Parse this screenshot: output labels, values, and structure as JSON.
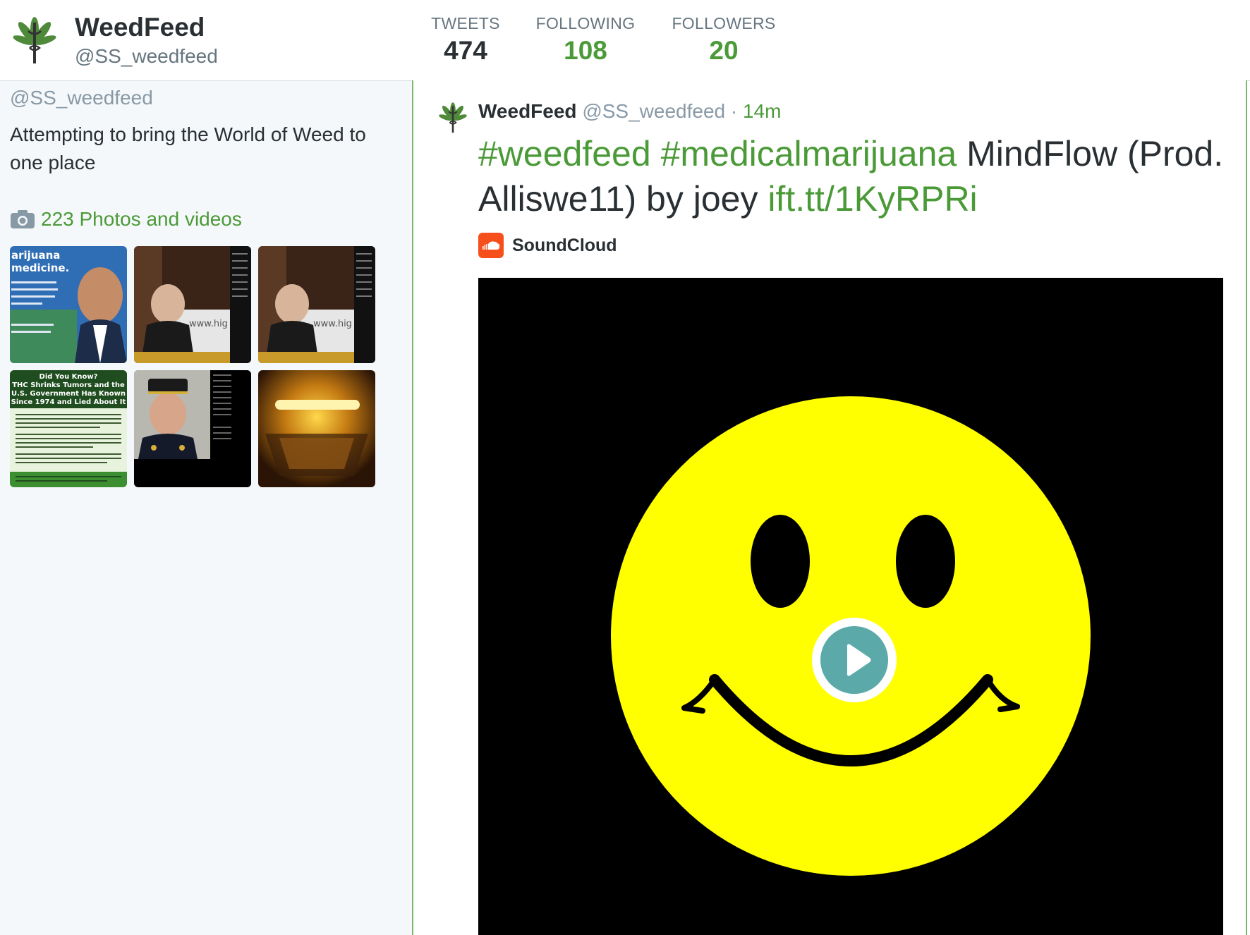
{
  "header": {
    "name": "WeedFeed",
    "handle": "@SS_weedfeed",
    "avatar_icon": "cannabis-leaf-caduceus-icon",
    "stats": [
      {
        "label": "TWEETS",
        "value": "474",
        "active": true
      },
      {
        "label": "FOLLOWING",
        "value": "108",
        "active": false
      },
      {
        "label": "FOLLOWERS",
        "value": "20",
        "active": false
      }
    ]
  },
  "sidebar": {
    "handle": "@SS_weedfeed",
    "bio": "Attempting to bring the World of Weed to one place",
    "media_link": {
      "icon": "camera-icon",
      "label": "223 Photos and videos"
    },
    "thumbnails": [
      {
        "name": "thumb-marijuana-medicine",
        "lines": [
          "arijuana",
          "medicine."
        ]
      },
      {
        "name": "thumb-speaker-1",
        "lines": [
          "www.hig"
        ]
      },
      {
        "name": "thumb-speaker-2",
        "lines": [
          "www.hig"
        ]
      },
      {
        "name": "thumb-thc-tumors",
        "lines": [
          "Did You Know?",
          "THC Shrinks Tumors and the",
          "U.S. Government Has Known",
          "Since 1974 and Lied About It"
        ]
      },
      {
        "name": "thumb-police-chief",
        "lines": []
      },
      {
        "name": "thumb-glowing-light",
        "lines": []
      }
    ]
  },
  "tweet": {
    "name": "WeedFeed",
    "handle": "@SS_weedfeed",
    "separator": "·",
    "time": "14m",
    "hashtag1": "#weedfeed",
    "hashtag2": "#medicalmarijuana",
    "text": "MindFlow (Prod. Alliswe11) by joey",
    "link": "ift.tt/1KyRPRi",
    "card": {
      "source_icon": "soundcloud-icon",
      "source_label": "SoundCloud",
      "play_icon": "play-icon"
    }
  },
  "colors": {
    "accent": "#4b9a38",
    "secondary_text": "#8899a6",
    "player_background": "#000000",
    "smiley": "#ffff00",
    "play": "#5ba9a9",
    "soundcloud": "#f74f1b"
  }
}
